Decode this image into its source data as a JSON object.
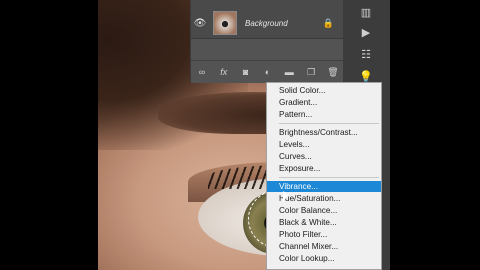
{
  "layers_panel": {
    "layers": [
      {
        "name": "Background",
        "visible": true,
        "locked": true
      }
    ],
    "toolbar_icons": [
      "link-icon",
      "fx-icon",
      "mask-icon",
      "adjustment-layer-icon",
      "group-folder-icon",
      "new-layer-icon",
      "trash-icon"
    ]
  },
  "tool_strip": {
    "icons": [
      "history-icon",
      "play-icon",
      "properties-icon",
      "bulb-icon"
    ]
  },
  "adjustment_menu": {
    "groups": [
      [
        "Solid Color...",
        "Gradient...",
        "Pattern..."
      ],
      [
        "Brightness/Contrast...",
        "Levels...",
        "Curves...",
        "Exposure..."
      ],
      [
        "Vibrance...",
        "Hue/Saturation...",
        "Color Balance...",
        "Black & White...",
        "Photo Filter...",
        "Channel Mixer...",
        "Color Lookup..."
      ]
    ],
    "highlighted": "Vibrance..."
  },
  "colors": {
    "highlight": "#1c88d6",
    "menu_bg": "#f0f0f0",
    "panel_bg": "#535353"
  }
}
